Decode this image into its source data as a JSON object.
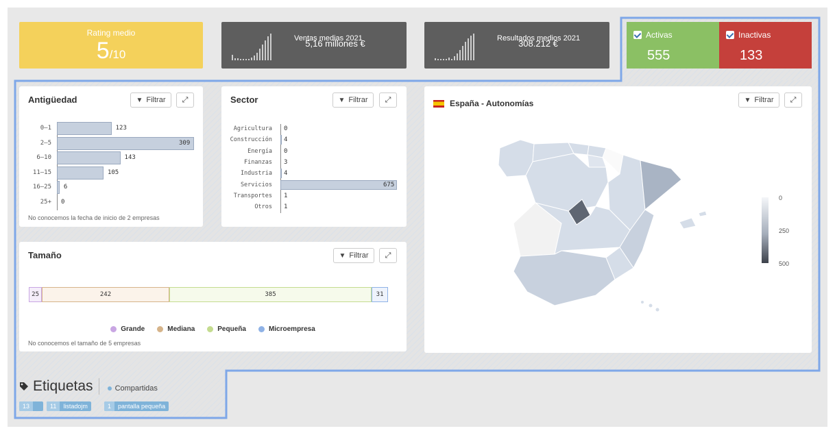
{
  "kpis": {
    "rating": {
      "label": "Rating medio",
      "value": "5",
      "suffix": "/10"
    },
    "ventas": {
      "label": "Ventas medias 2021",
      "value": "5,16 millones €"
    },
    "resultados": {
      "label": "Resultados medios 2021",
      "value": "308.212 €"
    }
  },
  "status": {
    "activas": {
      "label": "Activas",
      "value": "555",
      "color": "#8bc064"
    },
    "inactivas": {
      "label": "Inactivas",
      "value": "133",
      "color": "#c5403b"
    }
  },
  "buttons": {
    "filter": "Filtrar"
  },
  "antiguedad": {
    "title": "Antigüedad",
    "note": "No conocemos la fecha de inicio de 2 empresas",
    "chart_data": {
      "type": "bar",
      "categories": [
        "0–1",
        "2–5",
        "6–10",
        "11–15",
        "16–25",
        "25+"
      ],
      "values": [
        123,
        309,
        143,
        105,
        6,
        0
      ]
    }
  },
  "sector": {
    "title": "Sector",
    "chart_data": {
      "type": "bar",
      "categories": [
        "Agricultura",
        "Construcción",
        "Energía",
        "Finanzas",
        "Industria",
        "Servicios",
        "Transportes",
        "Otros"
      ],
      "values": [
        0,
        4,
        0,
        3,
        4,
        675,
        1,
        1
      ]
    }
  },
  "tamano": {
    "title": "Tamaño",
    "note": "No conocemos el tamaño de 5 empresas",
    "chart_data": {
      "type": "bar",
      "categories": [
        "Grande",
        "Mediana",
        "Pequeña",
        "Microempresa"
      ],
      "values": [
        25,
        242,
        385,
        31
      ]
    },
    "legend": [
      {
        "label": "Grande",
        "color": "#c9a6e3"
      },
      {
        "label": "Mediana",
        "color": "#d6b48a"
      },
      {
        "label": "Pequeña",
        "color": "#c4dc8f"
      },
      {
        "label": "Microempresa",
        "color": "#8fb2e6"
      }
    ]
  },
  "map": {
    "title": "España - Autonomías",
    "scale": {
      "labels": [
        "0",
        "250",
        "500"
      ]
    }
  },
  "etiquetas": {
    "title": "Etiquetas",
    "shared": "Compartidas",
    "tags": [
      {
        "count": "13",
        "label": ""
      },
      {
        "count": "11",
        "label": "listadojm"
      },
      {
        "count": "1",
        "label": "pantalla pequeña"
      }
    ]
  }
}
